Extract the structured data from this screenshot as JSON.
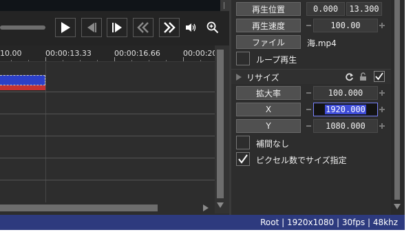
{
  "preview": {
    "controls": [
      {
        "name": "play",
        "icon": "play-icon"
      },
      {
        "name": "frame-back",
        "icon": "step-back-icon"
      },
      {
        "name": "frame-forward",
        "icon": "step-forward-icon"
      },
      {
        "name": "rewind",
        "icon": "rewind-icon"
      },
      {
        "name": "fast-forward",
        "icon": "fast-forward-icon"
      },
      {
        "name": "volume",
        "icon": "volume-icon"
      },
      {
        "name": "zoom",
        "icon": "zoom-icon"
      }
    ]
  },
  "timeline": {
    "ruler": [
      "10.00",
      "00:00:13.33",
      "00:00:16.66",
      "00:00:20"
    ],
    "clip_colors": {
      "video": "#2c40c8",
      "audio": "#c43232"
    }
  },
  "properties": {
    "playback_position": {
      "label": "再生位置",
      "start": "0.000",
      "end": "13.300"
    },
    "playback_speed": {
      "label": "再生速度",
      "value": "100.00"
    },
    "file": {
      "label": "ファイル",
      "value": "海.mp4"
    },
    "loop": {
      "label": "ループ再生",
      "checked": false
    },
    "resize_section": {
      "title": "リサイズ"
    },
    "scale": {
      "label": "拡大率",
      "value": "100.000"
    },
    "x": {
      "label": "X",
      "value": "1920.000"
    },
    "y": {
      "label": "Y",
      "value": "1080.000"
    },
    "no_interpolation": {
      "label": "補間なし",
      "checked": false
    },
    "size_by_pixels": {
      "label": "ピクセル数でサイズ指定",
      "checked": true
    }
  },
  "status_bar": {
    "text": "Root  |  1920x1080  |  30fps  |  48khz",
    "color": "#2d3a7e"
  }
}
